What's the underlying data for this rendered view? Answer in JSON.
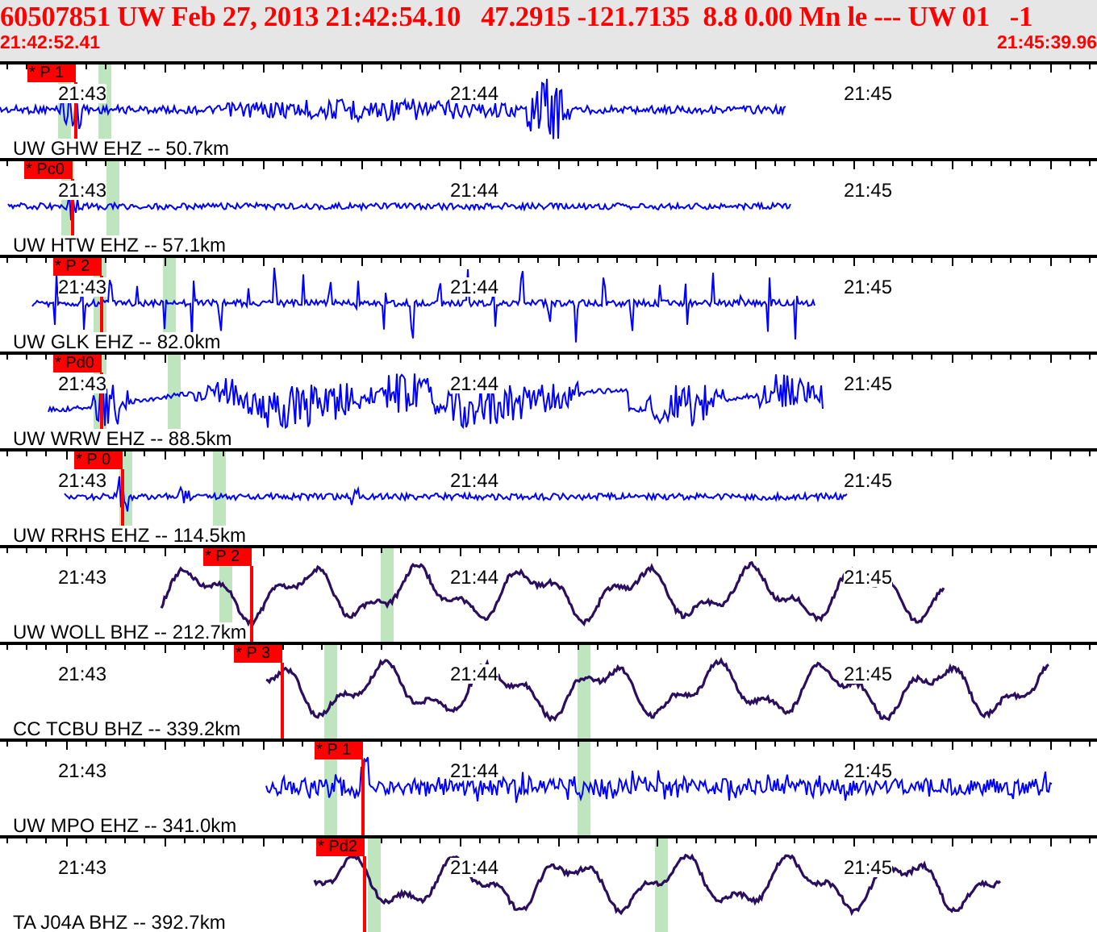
{
  "event": {
    "title": "60507851 UW Feb 27, 2013 21:42:54.10   47.2915 -121.7135  8.8 0.00 Mn le --- UW 01   -1",
    "start_time": "21:42:52.41",
    "end_time": "21:45:39.96"
  },
  "traces": [
    {
      "station": "UW GHW EHZ -- 50.7km",
      "pick": "* P 1",
      "time_labels": [
        "21:43",
        "21:44",
        "21:45"
      ],
      "color": "#0000ff"
    },
    {
      "station": "UW HTW EHZ -- 57.1km",
      "pick": "* Pc0",
      "time_labels": [
        "21:43",
        "21:44",
        "21:45"
      ],
      "color": "#0000ff"
    },
    {
      "station": "UW GLK EHZ -- 82.0km",
      "pick": "* P 2",
      "time_labels": [
        "21:43",
        "21:44",
        "21:45"
      ],
      "color": "#0000ff"
    },
    {
      "station": "UW WRW EHZ -- 88.5km",
      "pick": "* Pd0",
      "time_labels": [
        "21:43",
        "21:44",
        "21:45"
      ],
      "color": "#0000ff"
    },
    {
      "station": "UW RRHS EHZ -- 114.5km",
      "pick": "* P 0",
      "time_labels": [
        "21:43",
        "21:44",
        "21:45"
      ],
      "color": "#0000ff"
    },
    {
      "station": "UW WOLL BHZ -- 212.7km",
      "pick": "* P 2",
      "time_labels": [
        "21:43",
        "21:44",
        "21:45"
      ],
      "color": "#2b0f5e"
    },
    {
      "station": "CC TCBU BHZ -- 339.2km",
      "pick": "* P 3",
      "time_labels": [
        "21:43",
        "21:44",
        "21:45"
      ],
      "color": "#2b0f5e"
    },
    {
      "station": "UW MPO EHZ -- 341.0km",
      "pick": "* P 1",
      "time_labels": [
        "21:43",
        "21:44",
        "21:45"
      ],
      "color": "#0000ff"
    },
    {
      "station": "TA J04A BHZ -- 392.7km",
      "pick": "* Pd2",
      "time_labels": [
        "21:43",
        "21:44",
        "21:45"
      ],
      "color": "#2b0f5e"
    }
  ]
}
